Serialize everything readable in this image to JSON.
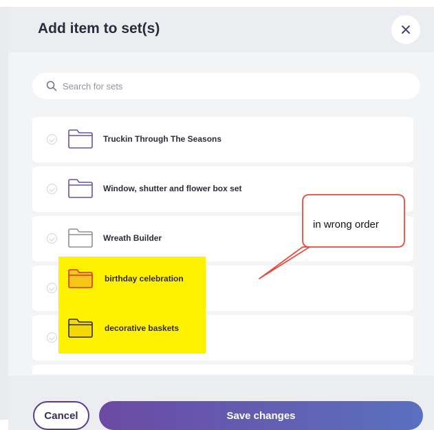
{
  "dialog": {
    "title": "Add item to set(s)",
    "close_icon": "close-icon"
  },
  "search": {
    "placeholder": "Search for sets",
    "icon": "search-icon"
  },
  "sets": [
    {
      "label": "Truckin Through The Seasons",
      "folder_color": "#6c4ea3",
      "checked": false
    },
    {
      "label": "Window, shutter and flower box set",
      "folder_color": "#6c4ea3",
      "checked": false
    },
    {
      "label": "Wreath Builder",
      "folder_color": "#8a8f98",
      "checked": false
    },
    {
      "label": "birthday celebration",
      "folder_color": "#d9331f",
      "checked": false
    },
    {
      "label": "decorative baskets",
      "folder_color": "#2b2b2b",
      "checked": false
    }
  ],
  "annotation": {
    "text": "in wrong order",
    "highlight_color": "#fff200",
    "border_color": "#e84b3c"
  },
  "footer": {
    "cancel_label": "Cancel",
    "save_label": "Save changes"
  }
}
